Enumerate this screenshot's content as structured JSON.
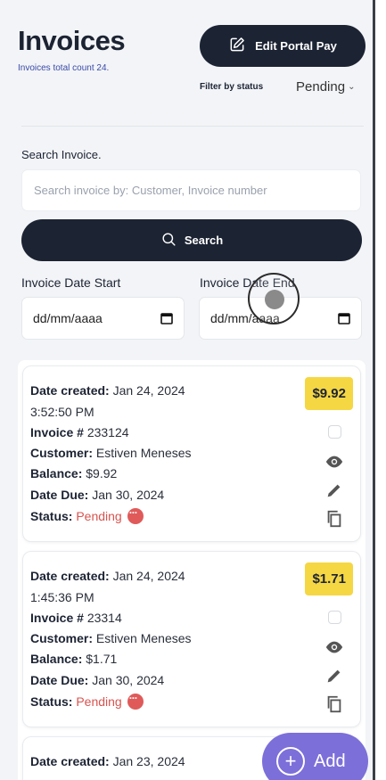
{
  "header": {
    "title": "Invoices",
    "subtitle": "Invoices total count 24.",
    "edit_button_label": "Edit Portal Pay",
    "filter_label": "Filter by status",
    "filter_value": "Pending"
  },
  "search": {
    "label": "Search Invoice.",
    "placeholder": "Search invoice by: Customer, Invoice number",
    "button_label": "Search"
  },
  "dates": {
    "start_label": "Invoice Date Start",
    "start_value": "dd/mm/aaaa",
    "end_label": "Invoice Date End",
    "end_value": "dd/mm/aaaa"
  },
  "labels": {
    "date_created": "Date created:",
    "invoice": "Invoice #",
    "customer": "Customer:",
    "balance": "Balance:",
    "date_due": "Date Due:",
    "status": "Status:"
  },
  "invoices": [
    {
      "amount": "$9.92",
      "date_created": "Jan 24, 2024",
      "time_created": "3:52:50 PM",
      "invoice_number": "233124",
      "customer": "Estiven Meneses",
      "balance": "$9.92",
      "date_due": "Jan 30, 2024",
      "status": "Pending"
    },
    {
      "amount": "$1.71",
      "date_created": "Jan 24, 2024",
      "time_created": "1:45:36 PM",
      "invoice_number": "23314",
      "customer": "Estiven Meneses",
      "balance": "$1.71",
      "date_due": "Jan 30, 2024",
      "status": "Pending"
    },
    {
      "date_created": "Jan 23, 2024"
    }
  ],
  "fab": {
    "label": "Add"
  },
  "colors": {
    "primary": "#1c2333",
    "badge": "#f5d743",
    "status_pending": "#d9534f",
    "fab": "#7c6fd9",
    "background": "#f2f4f7"
  }
}
